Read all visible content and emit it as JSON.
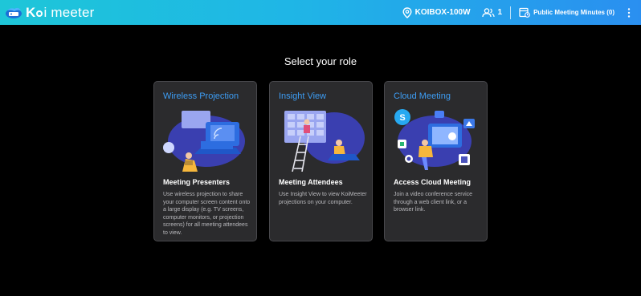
{
  "app": {
    "logo_prefix": "K",
    "logo_rest": "i meeter",
    "brand_gradient": [
      "#1ec6d8",
      "#2a8ff0"
    ]
  },
  "header": {
    "location_icon": "location-pin-icon",
    "device_name": "KOIBOX-100W",
    "users_icon": "users-icon",
    "user_count": "1",
    "minutes_icon": "meeting-minutes-icon",
    "minutes_label": "Public Meeting Minutes (0)",
    "menu_icon": "more-vertical-icon"
  },
  "main": {
    "title": "Select your role",
    "accent": "#3d9df4",
    "cards": [
      {
        "title": "Wireless Projection",
        "subtitle": "Meeting Presenters",
        "description": "Use wireless projection to share your computer screen content onto a large display (e.g. TV screens, computer monitors, or projection screens) for all meeting attendees to view."
      },
      {
        "title": "Insight View",
        "subtitle": "Meeting Attendees",
        "description": "Use Insight View to view KoiMeeter projections on your computer."
      },
      {
        "title": "Cloud Meeting",
        "subtitle": "Access Cloud Meeting",
        "description": "Join a video conference service through a web client link, or a browser link."
      }
    ]
  }
}
